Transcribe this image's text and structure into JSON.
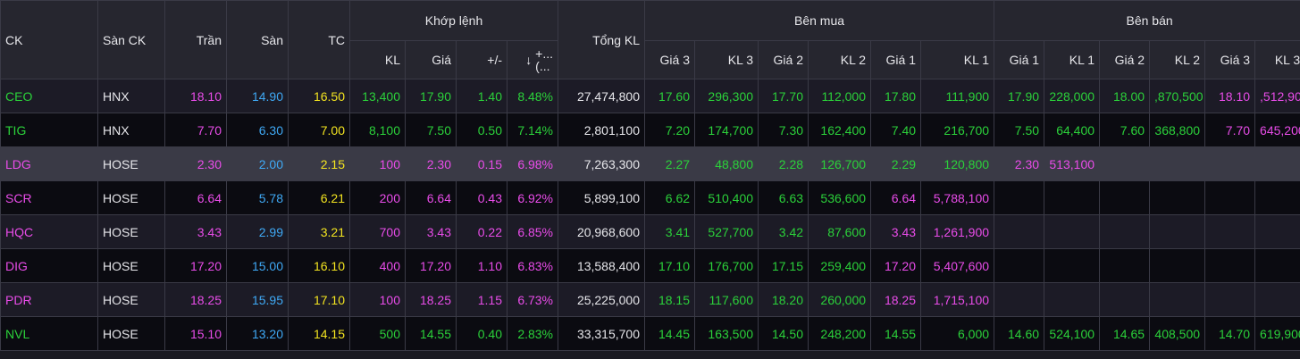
{
  "headers": {
    "ck": "CK",
    "exchange": "Sàn CK",
    "ceiling": "Trần",
    "floor": "Sàn",
    "ref": "TC",
    "match_group": "Khớp lệnh",
    "match_kl": "KL",
    "match_price": "Giá",
    "match_change": "+/-",
    "match_pct_line1": "+...",
    "match_pct_line2": "(...",
    "total_kl": "Tổng KL",
    "buy_group": "Bên mua",
    "buy": [
      "Giá 3",
      "KL 3",
      "Giá 2",
      "KL 2",
      "Giá 1",
      "KL 1"
    ],
    "sell_group": "Bên bán",
    "sell": [
      "Giá 1",
      "KL 1",
      "Giá 2",
      "KL 2",
      "Giá 3",
      "KL 3"
    ]
  },
  "colors": {
    "up": "#2bd13a",
    "ceiling": "#e94ce9",
    "floor": "#3fa9f5",
    "reference": "#f2e320"
  },
  "rows": [
    {
      "sym": "CEO",
      "exch": "HNX",
      "ceil": "18.10",
      "floor": "14.90",
      "ref": "16.50",
      "kl": "13,400",
      "price": "17.90",
      "chg": "1.40",
      "pct": "8.48%",
      "total": "27,474,800",
      "b3p": "17.60",
      "b3v": "296,300",
      "b2p": "17.70",
      "b2v": "112,000",
      "b1p": "17.80",
      "b1v": "111,900",
      "s1p": "17.90",
      "s1v": "228,000",
      "s2p": "18.00",
      "s2v": ",870,500",
      "s3p": "18.10",
      "s3v": ",512,900"
    },
    {
      "sym": "TIG",
      "exch": "HNX",
      "ceil": "7.70",
      "floor": "6.30",
      "ref": "7.00",
      "kl": "8,100",
      "price": "7.50",
      "chg": "0.50",
      "pct": "7.14%",
      "total": "2,801,100",
      "b3p": "7.20",
      "b3v": "174,700",
      "b2p": "7.30",
      "b2v": "162,400",
      "b1p": "7.40",
      "b1v": "216,700",
      "s1p": "7.50",
      "s1v": "64,400",
      "s2p": "7.60",
      "s2v": "368,800",
      "s3p": "7.70",
      "s3v": "645,200"
    },
    {
      "sym": "LDG",
      "exch": "HOSE",
      "ceil": "2.30",
      "floor": "2.00",
      "ref": "2.15",
      "kl": "100",
      "price": "2.30",
      "chg": "0.15",
      "pct": "6.98%",
      "total": "7,263,300",
      "b3p": "2.27",
      "b3v": "48,800",
      "b2p": "2.28",
      "b2v": "126,700",
      "b1p": "2.29",
      "b1v": "120,800",
      "s1p": "2.30",
      "s1v": "513,100",
      "s2p": "",
      "s2v": "",
      "s3p": "",
      "s3v": ""
    },
    {
      "sym": "SCR",
      "exch": "HOSE",
      "ceil": "6.64",
      "floor": "5.78",
      "ref": "6.21",
      "kl": "200",
      "price": "6.64",
      "chg": "0.43",
      "pct": "6.92%",
      "total": "5,899,100",
      "b3p": "6.62",
      "b3v": "510,400",
      "b2p": "6.63",
      "b2v": "536,600",
      "b1p": "6.64",
      "b1v": "5,788,100",
      "s1p": "",
      "s1v": "",
      "s2p": "",
      "s2v": "",
      "s3p": "",
      "s3v": ""
    },
    {
      "sym": "HQC",
      "exch": "HOSE",
      "ceil": "3.43",
      "floor": "2.99",
      "ref": "3.21",
      "kl": "700",
      "price": "3.43",
      "chg": "0.22",
      "pct": "6.85%",
      "total": "20,968,600",
      "b3p": "3.41",
      "b3v": "527,700",
      "b2p": "3.42",
      "b2v": "87,600",
      "b1p": "3.43",
      "b1v": "1,261,900",
      "s1p": "",
      "s1v": "",
      "s2p": "",
      "s2v": "",
      "s3p": "",
      "s3v": ""
    },
    {
      "sym": "DIG",
      "exch": "HOSE",
      "ceil": "17.20",
      "floor": "15.00",
      "ref": "16.10",
      "kl": "400",
      "price": "17.20",
      "chg": "1.10",
      "pct": "6.83%",
      "total": "13,588,400",
      "b3p": "17.10",
      "b3v": "176,700",
      "b2p": "17.15",
      "b2v": "259,400",
      "b1p": "17.20",
      "b1v": "5,407,600",
      "s1p": "",
      "s1v": "",
      "s2p": "",
      "s2v": "",
      "s3p": "",
      "s3v": ""
    },
    {
      "sym": "PDR",
      "exch": "HOSE",
      "ceil": "18.25",
      "floor": "15.95",
      "ref": "17.10",
      "kl": "100",
      "price": "18.25",
      "chg": "1.15",
      "pct": "6.73%",
      "total": "25,225,000",
      "b3p": "18.15",
      "b3v": "117,600",
      "b2p": "18.20",
      "b2v": "260,000",
      "b1p": "18.25",
      "b1v": "1,715,100",
      "s1p": "",
      "s1v": "",
      "s2p": "",
      "s2v": "",
      "s3p": "",
      "s3v": ""
    },
    {
      "sym": "NVL",
      "exch": "HOSE",
      "ceil": "15.10",
      "floor": "13.20",
      "ref": "14.15",
      "kl": "500",
      "price": "14.55",
      "chg": "0.40",
      "pct": "2.83%",
      "total": "33,315,700",
      "b3p": "14.45",
      "b3v": "163,500",
      "b2p": "14.50",
      "b2v": "248,200",
      "b1p": "14.55",
      "b1v": "6,000",
      "s1p": "14.60",
      "s1v": "524,100",
      "s2p": "14.65",
      "s2v": "408,500",
      "s3p": "14.70",
      "s3v": "619,900"
    }
  ]
}
